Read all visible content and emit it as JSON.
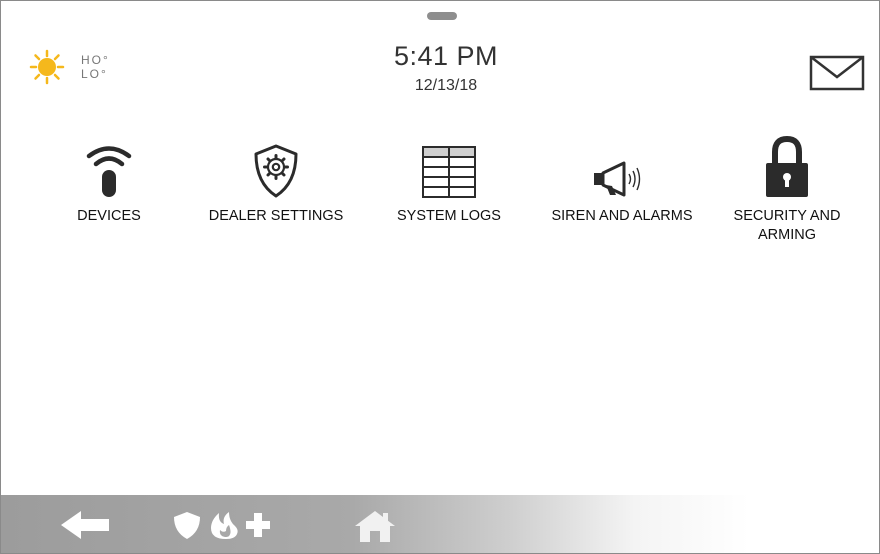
{
  "weather": {
    "icon": "sun-icon",
    "high_label": "HO°",
    "low_label": "LO°"
  },
  "clock": {
    "time": "5:41 PM",
    "date": "12/13/18"
  },
  "header": {
    "messages_icon": "envelope-icon"
  },
  "tiles": [
    {
      "label": "DEVICES",
      "icon": "wifi-remote-icon"
    },
    {
      "label": "DEALER SETTINGS",
      "icon": "gear-shield-icon"
    },
    {
      "label": "SYSTEM LOGS",
      "icon": "table-icon"
    },
    {
      "label": "SIREN AND ALARMS",
      "icon": "megaphone-icon"
    },
    {
      "label": "SECURITY AND ARMING",
      "icon": "lock-icon"
    }
  ],
  "footer": {
    "back_icon": "back-arrow-icon",
    "emergency_icons": [
      "shield-icon",
      "flame-icon",
      "medical-cross-icon"
    ],
    "home_icon": "home-icon"
  },
  "colors": {
    "sun": "#f5b81c",
    "icon_dark": "#2b2b2b",
    "bar_gray": "#a0a0a0"
  }
}
